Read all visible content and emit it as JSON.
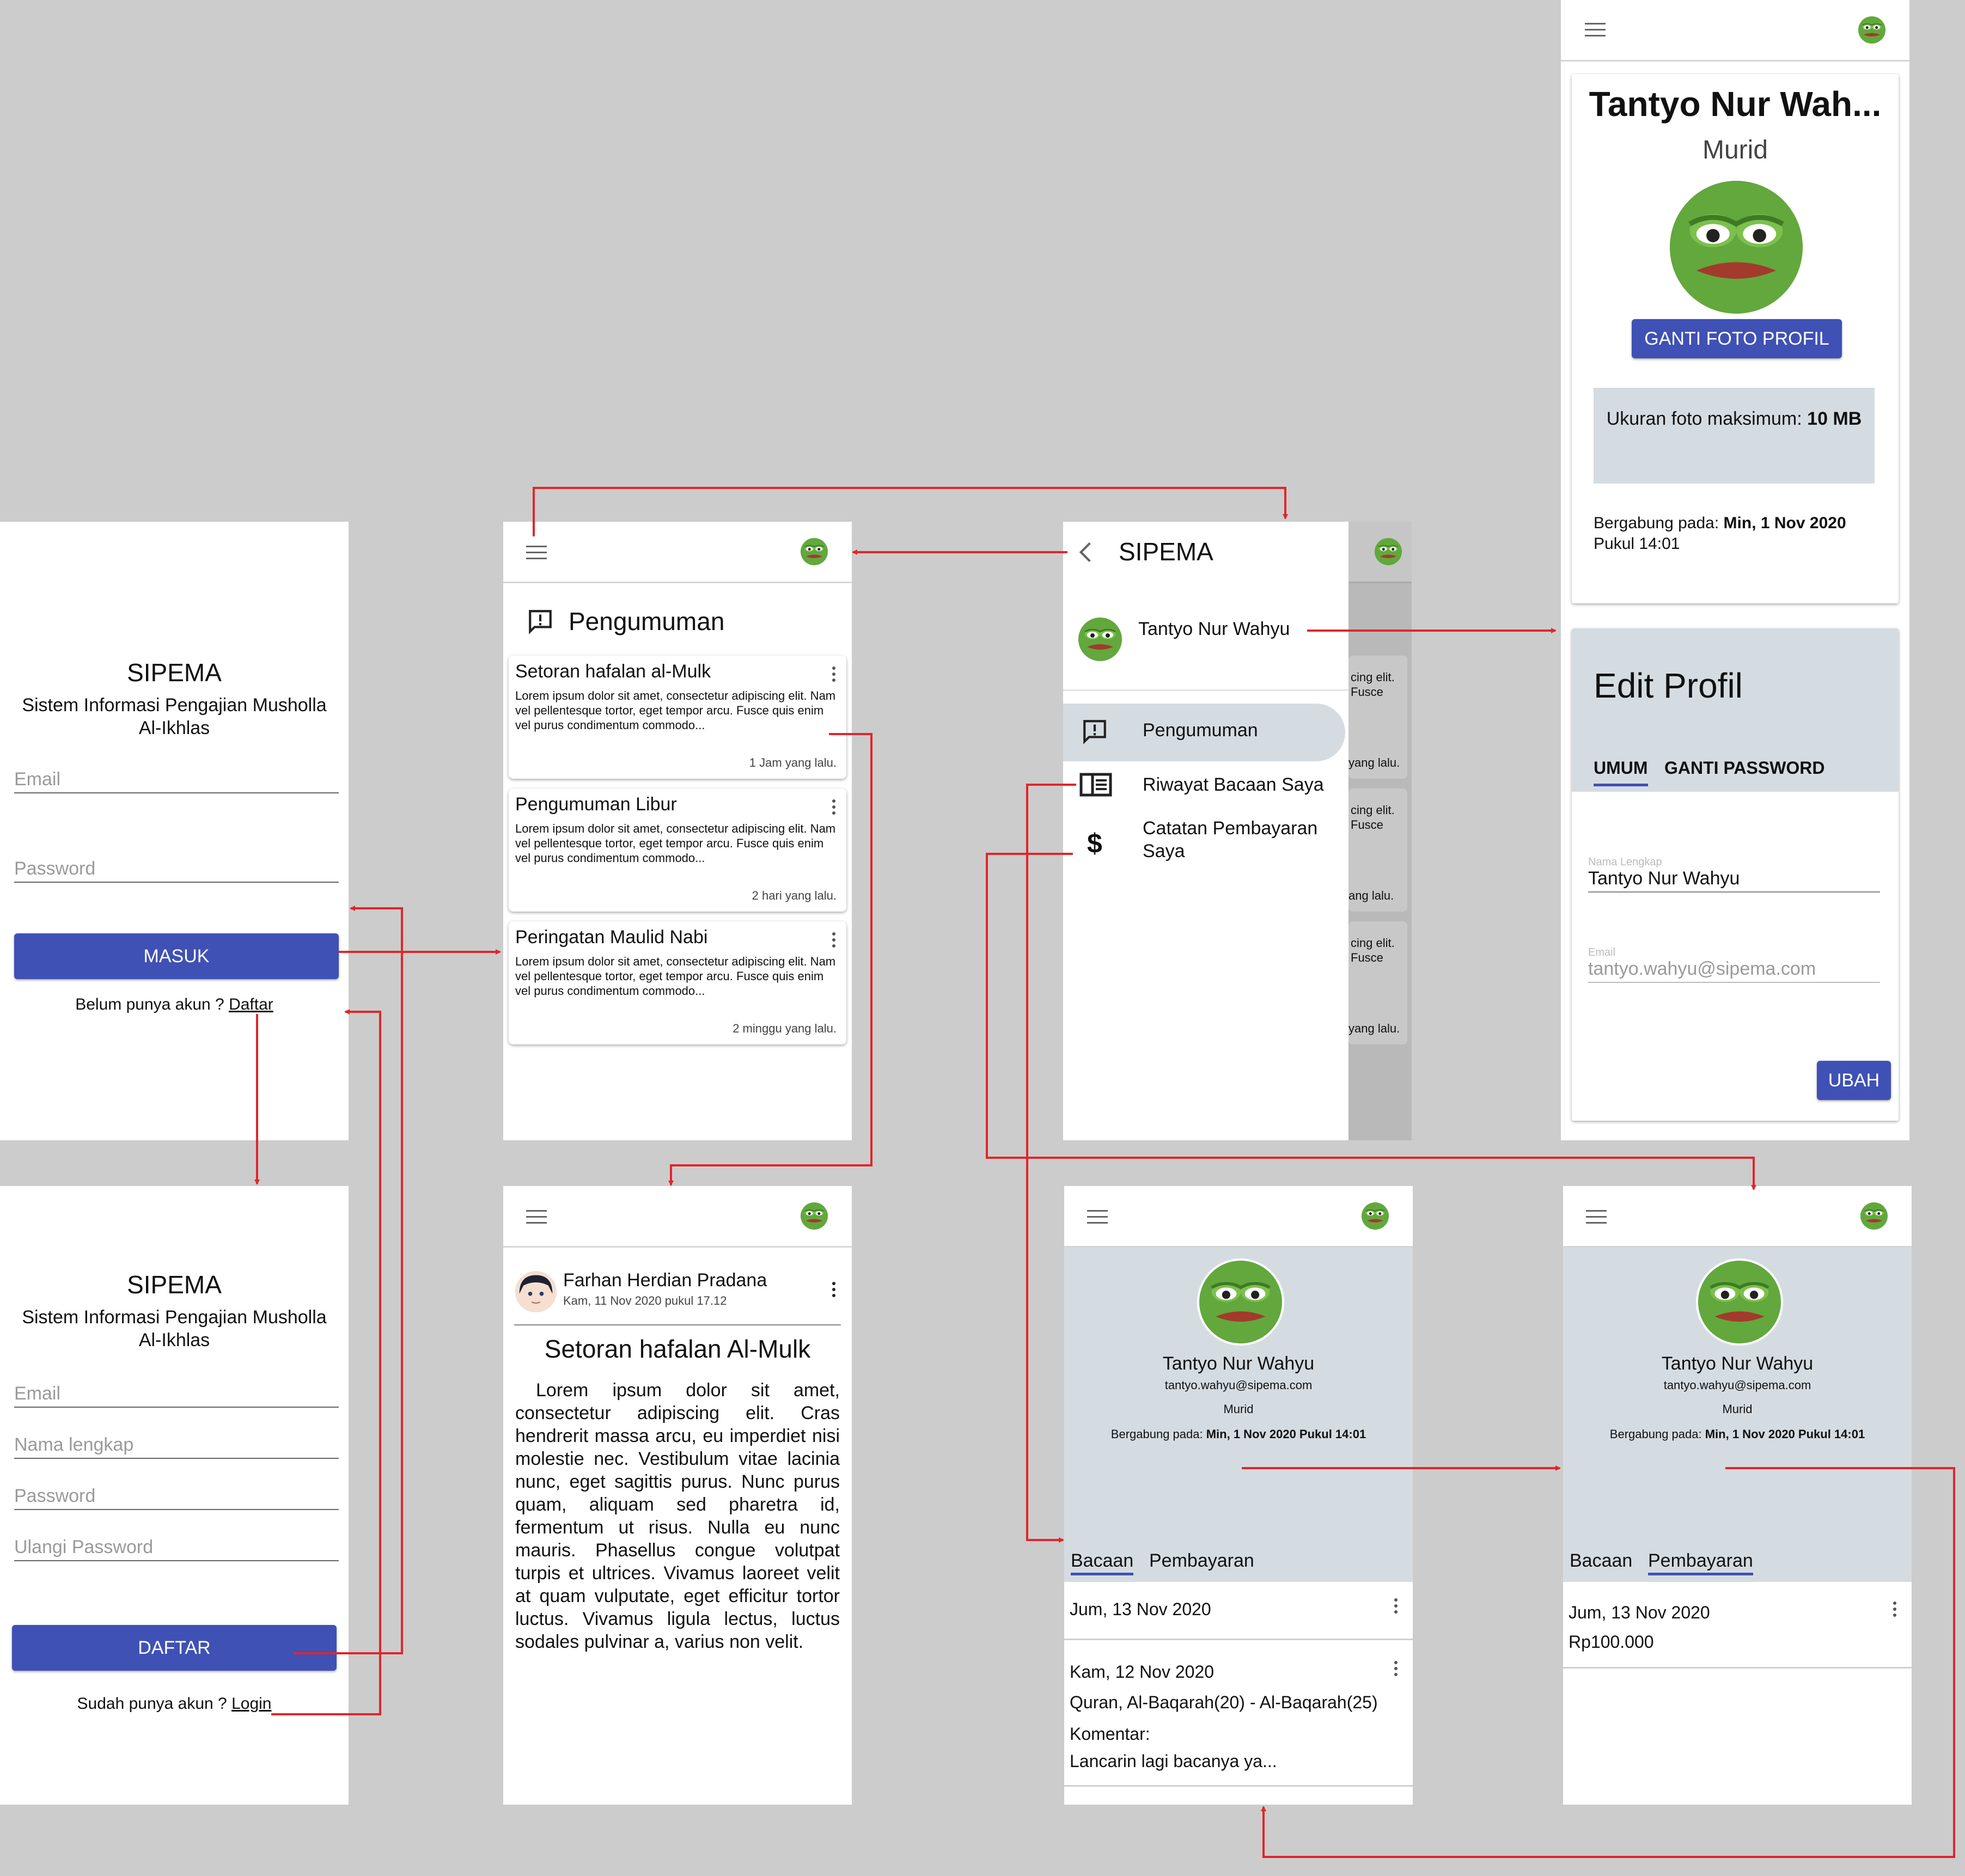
{
  "colors": {
    "primary": "#3f51b5",
    "flow_arrow": "#e0262b",
    "canvas": "#cccccc",
    "panel": "#d5dce1"
  },
  "app": {
    "name": "SIPEMA",
    "subtitle": "Sistem Informasi Pengajian Musholla Al-Ikhlas"
  },
  "login": {
    "email_placeholder": "Email",
    "password_placeholder": "Password",
    "submit_label": "MASUK",
    "register_prompt": "Belum punya akun ?",
    "register_link": "Daftar"
  },
  "register": {
    "email_placeholder": "Email",
    "name_placeholder": "Nama lengkap",
    "password_placeholder": "Password",
    "repeat_placeholder": "Ulangi Password",
    "submit_label": "DAFTAR",
    "login_prompt": "Sudah punya akun ?",
    "login_link": "Login"
  },
  "announcements": {
    "heading": "Pengumuman",
    "items": [
      {
        "title": "Setoran hafalan al-Mulk",
        "body": "Lorem ipsum dolor sit amet, consectetur adipiscing elit. Nam vel pellentesque tortor, eget tempor arcu. Fusce quis enim vel purus condimentum commodo...",
        "time": "1 Jam yang lalu."
      },
      {
        "title": "Pengumuman Libur",
        "body": "Lorem ipsum dolor sit amet, consectetur adipiscing elit. Nam vel pellentesque tortor, eget tempor arcu. Fusce quis enim vel purus condimentum commodo...",
        "time": "2 hari yang lalu."
      },
      {
        "title": "Peringatan Maulid Nabi",
        "body": "Lorem ipsum dolor sit amet, consectetur adipiscing elit. Nam vel pellentesque tortor, eget tempor arcu. Fusce quis enim vel purus condimentum commodo...",
        "time": "2 minggu yang lalu."
      }
    ]
  },
  "drawer": {
    "title": "SIPEMA",
    "user": "Tantyo Nur Wahyu",
    "items": [
      "Pengumuman",
      "Riwayat Bacaan Saya",
      "Catatan Pembayaran Saya"
    ],
    "peek": {
      "text1": "cing elit.",
      "text2": "Fusce",
      "time1": "yang lalu.",
      "time2": "ang lalu.",
      "time3": "yang lalu."
    }
  },
  "profile": {
    "name_truncated": "Tantyo Nur Wah...",
    "role": "Murid",
    "change_photo": "GANTI FOTO PROFIL",
    "max_photo_label": "Ukuran foto maksimum:",
    "max_photo_value": "10 MB",
    "joined_label": "Bergabung pada:",
    "joined_value": "Min, 1 Nov 2020 Pukul 14:01",
    "joined_date": "Min, 1 Nov 2020",
    "joined_time_label": "Pukul 14:01"
  },
  "edit": {
    "title": "Edit Profil",
    "tab_general": "UMUM",
    "tab_password": "GANTI PASSWORD",
    "name_label": "Nama Lengkap",
    "name_value": "Tantyo Nur Wahyu",
    "email_label": "Email",
    "email_value": "tantyo.wahyu@sipema.com",
    "submit": "UBAH"
  },
  "detail": {
    "author": "Farhan Herdian Pradana",
    "date": "Kam, 11 Nov 2020 pukul 17.12",
    "title": "Setoran hafalan Al-Mulk",
    "body": "Lorem ipsum dolor sit amet, consectetur adipiscing elit. Cras hendrerit massa arcu, eu imperdiet nisi molestie nec. Vestibulum vitae lacinia nunc, eget sagittis purus. Nunc purus quam, aliquam sed pharetra id, fermentum ut risus. Nulla eu nunc mauris. Phasellus congue volutpat turpis et ultrices. Vivamus laoreet velit at quam vulputate, eget efficitur tortor luctus. Vivamus ligula lectus, luctus sodales pulvinar a, varius non velit."
  },
  "user_panel": {
    "name": "Tantyo Nur Wahyu",
    "email": "tantyo.wahyu@sipema.com",
    "role": "Murid",
    "joined_label": "Bergabung pada:",
    "joined_value": "Min, 1 Nov 2020 Pukul 14:01",
    "tab_reading": "Bacaan",
    "tab_payment": "Pembayaran"
  },
  "reading": {
    "items": [
      {
        "date": "Jum, 13 Nov 2020"
      },
      {
        "date": "Kam, 12 Nov 2020",
        "range": "Quran, Al-Baqarah(20) - Al-Baqarah(25)",
        "comment_label": "Komentar:",
        "comment": "Lancarin lagi bacanya ya..."
      }
    ]
  },
  "payment": {
    "items": [
      {
        "date": "Jum, 13 Nov 2020",
        "amount": "Rp100.000"
      }
    ]
  }
}
